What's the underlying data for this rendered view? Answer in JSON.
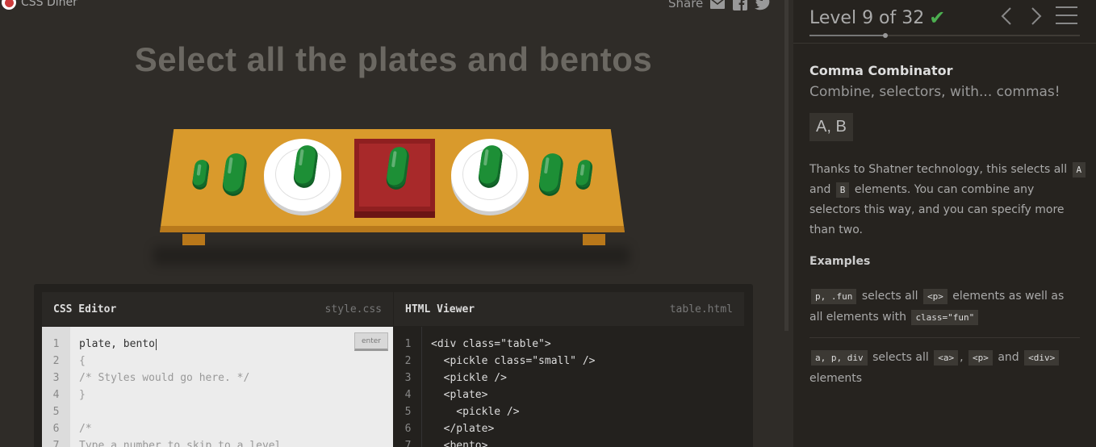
{
  "header": {
    "logo_text": "CSS Diner",
    "share_label": "Share",
    "share_icons": [
      "email-icon",
      "facebook-icon",
      "twitter-icon"
    ]
  },
  "instruction": "Select all the plates and bentos",
  "scene": {
    "items": [
      "pickle small",
      "pickle",
      "plate with pickle",
      "bento with pickle",
      "plate with pickle",
      "pickle",
      "pickle small"
    ],
    "colors": {
      "table": "#d99a2c",
      "pickle": "#1d8f36",
      "plate": "#ffffff",
      "bento": "#a8292a"
    }
  },
  "css_editor": {
    "title": "CSS Editor",
    "filename": "style.css",
    "input_value": "plate, bento",
    "enter_label": "enter",
    "lines": [
      {
        "n": "1",
        "text": "plate, bento"
      },
      {
        "n": "2",
        "text": "{"
      },
      {
        "n": "3",
        "text": "/* Styles would go here. */"
      },
      {
        "n": "4",
        "text": "}"
      },
      {
        "n": "5",
        "text": ""
      },
      {
        "n": "6",
        "text": "/*"
      },
      {
        "n": "7",
        "text": "Type a number to skip to a level."
      }
    ]
  },
  "html_viewer": {
    "title": "HTML Viewer",
    "filename": "table.html",
    "lines": [
      {
        "n": "1",
        "text": "<div class=\"table\">"
      },
      {
        "n": "2",
        "text": "  <pickle class=\"small\" />"
      },
      {
        "n": "3",
        "text": "  <pickle />"
      },
      {
        "n": "4",
        "text": "  <plate>"
      },
      {
        "n": "5",
        "text": "    <pickle />"
      },
      {
        "n": "6",
        "text": "  </plate>"
      },
      {
        "n": "7",
        "text": "  <bento>"
      }
    ]
  },
  "sidebar": {
    "level_text": "Level 9 of 32",
    "level_current": 9,
    "level_total": 32,
    "completed": true,
    "accent": "#4caf50",
    "selector_name": "Comma Combinator",
    "title": "Combine, selectors, with... commas!",
    "syntax": "A, B",
    "hint": {
      "t1": "Thanks to Shatner technology, this selects all",
      "a": "A",
      "t2": "and",
      "b": "B",
      "t3": "elements. You can combine any selectors this way, and you can specify more than two."
    },
    "examples_label": "Examples",
    "examples": [
      {
        "code": "p, .fun",
        "t1": "selects all",
        "c2": "<p>",
        "t2": "elements as well as all elements with",
        "c3": "class=\"fun\""
      },
      {
        "code": "a, p, div",
        "t1": "selects all",
        "c2": "<a>",
        "t2": ",",
        "c3": "<p>",
        "t3": "and",
        "c4": "<div>",
        "t4": "elements"
      }
    ]
  }
}
